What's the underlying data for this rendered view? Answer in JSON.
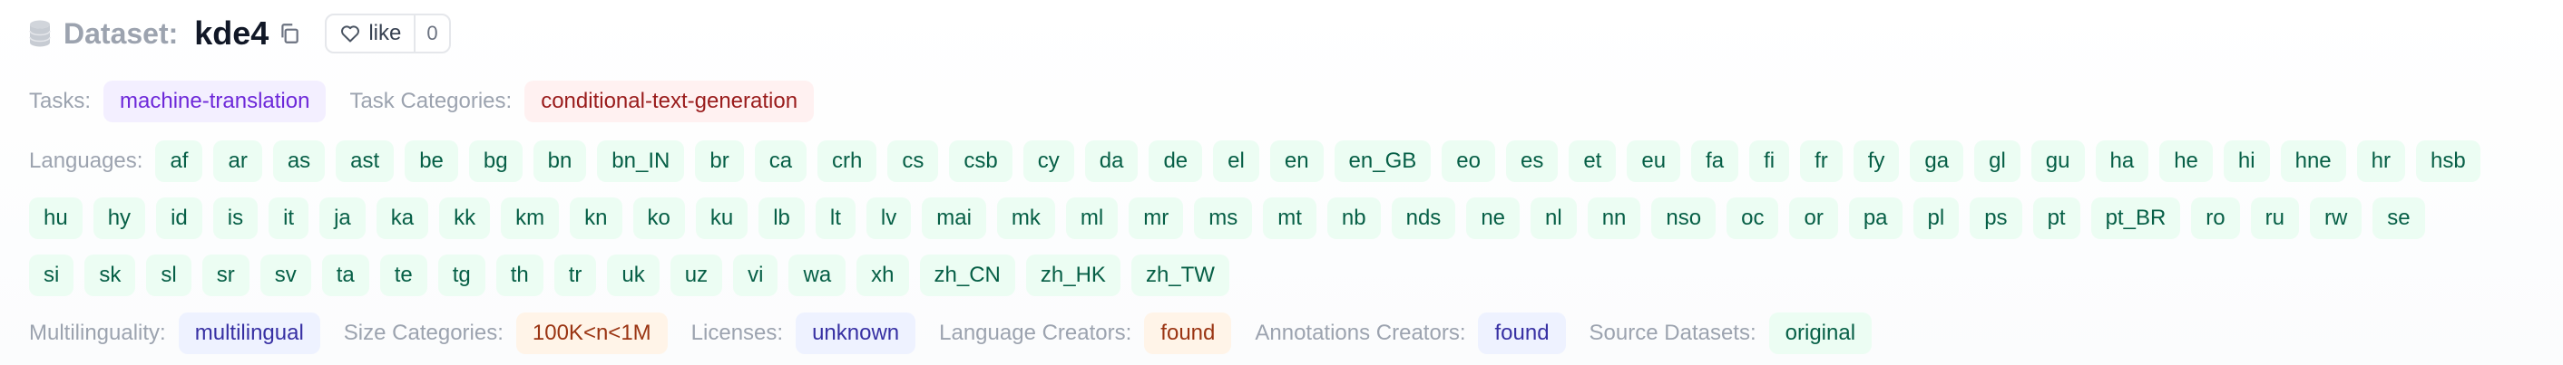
{
  "header": {
    "dataset_word": "Dataset:",
    "name": "kde4",
    "like_label": "like",
    "like_count": "0"
  },
  "tasks": {
    "label": "Tasks:",
    "value": "machine-translation"
  },
  "task_categories": {
    "label": "Task Categories:",
    "value": "conditional-text-generation"
  },
  "languages": {
    "label": "Languages:",
    "row1": [
      "af",
      "ar",
      "as",
      "ast",
      "be",
      "bg",
      "bn",
      "bn_IN",
      "br",
      "ca",
      "crh",
      "cs",
      "csb",
      "cy",
      "da",
      "de",
      "el",
      "en",
      "en_GB",
      "eo",
      "es",
      "et",
      "eu",
      "fa",
      "fi",
      "fr",
      "fy",
      "ga",
      "gl",
      "gu",
      "ha",
      "he",
      "hi",
      "hne",
      "hr",
      "hsb"
    ],
    "row2": [
      "hu",
      "hy",
      "id",
      "is",
      "it",
      "ja",
      "ka",
      "kk",
      "km",
      "kn",
      "ko",
      "ku",
      "lb",
      "lt",
      "lv",
      "mai",
      "mk",
      "ml",
      "mr",
      "ms",
      "mt",
      "nb",
      "nds",
      "ne",
      "nl",
      "nn",
      "nso",
      "oc",
      "or",
      "pa",
      "pl",
      "ps",
      "pt",
      "pt_BR",
      "ro",
      "ru",
      "rw",
      "se"
    ],
    "row3": [
      "si",
      "sk",
      "sl",
      "sr",
      "sv",
      "ta",
      "te",
      "tg",
      "th",
      "tr",
      "uk",
      "uz",
      "vi",
      "wa",
      "xh",
      "zh_CN",
      "zh_HK",
      "zh_TW"
    ]
  },
  "footer": {
    "multilinguality": {
      "label": "Multilinguality:",
      "value": "multilingual"
    },
    "size": {
      "label": "Size Categories:",
      "value": "100K<n<1M"
    },
    "licenses": {
      "label": "Licenses:",
      "value": "unknown"
    },
    "language_creators": {
      "label": "Language Creators:",
      "value": "found"
    },
    "annotations_creators": {
      "label": "Annotations Creators:",
      "value": "found"
    },
    "source_datasets": {
      "label": "Source Datasets:",
      "value": "original"
    }
  },
  "colors": {
    "task_chip": "#f3efff",
    "category_chip": "#fff1f1",
    "language_chip": "#ecfdf3",
    "blue_chip": "#eef2ff",
    "orange_chip": "#fff4e8"
  },
  "icons": [
    "database-icon",
    "copy-icon",
    "heart-icon"
  ]
}
